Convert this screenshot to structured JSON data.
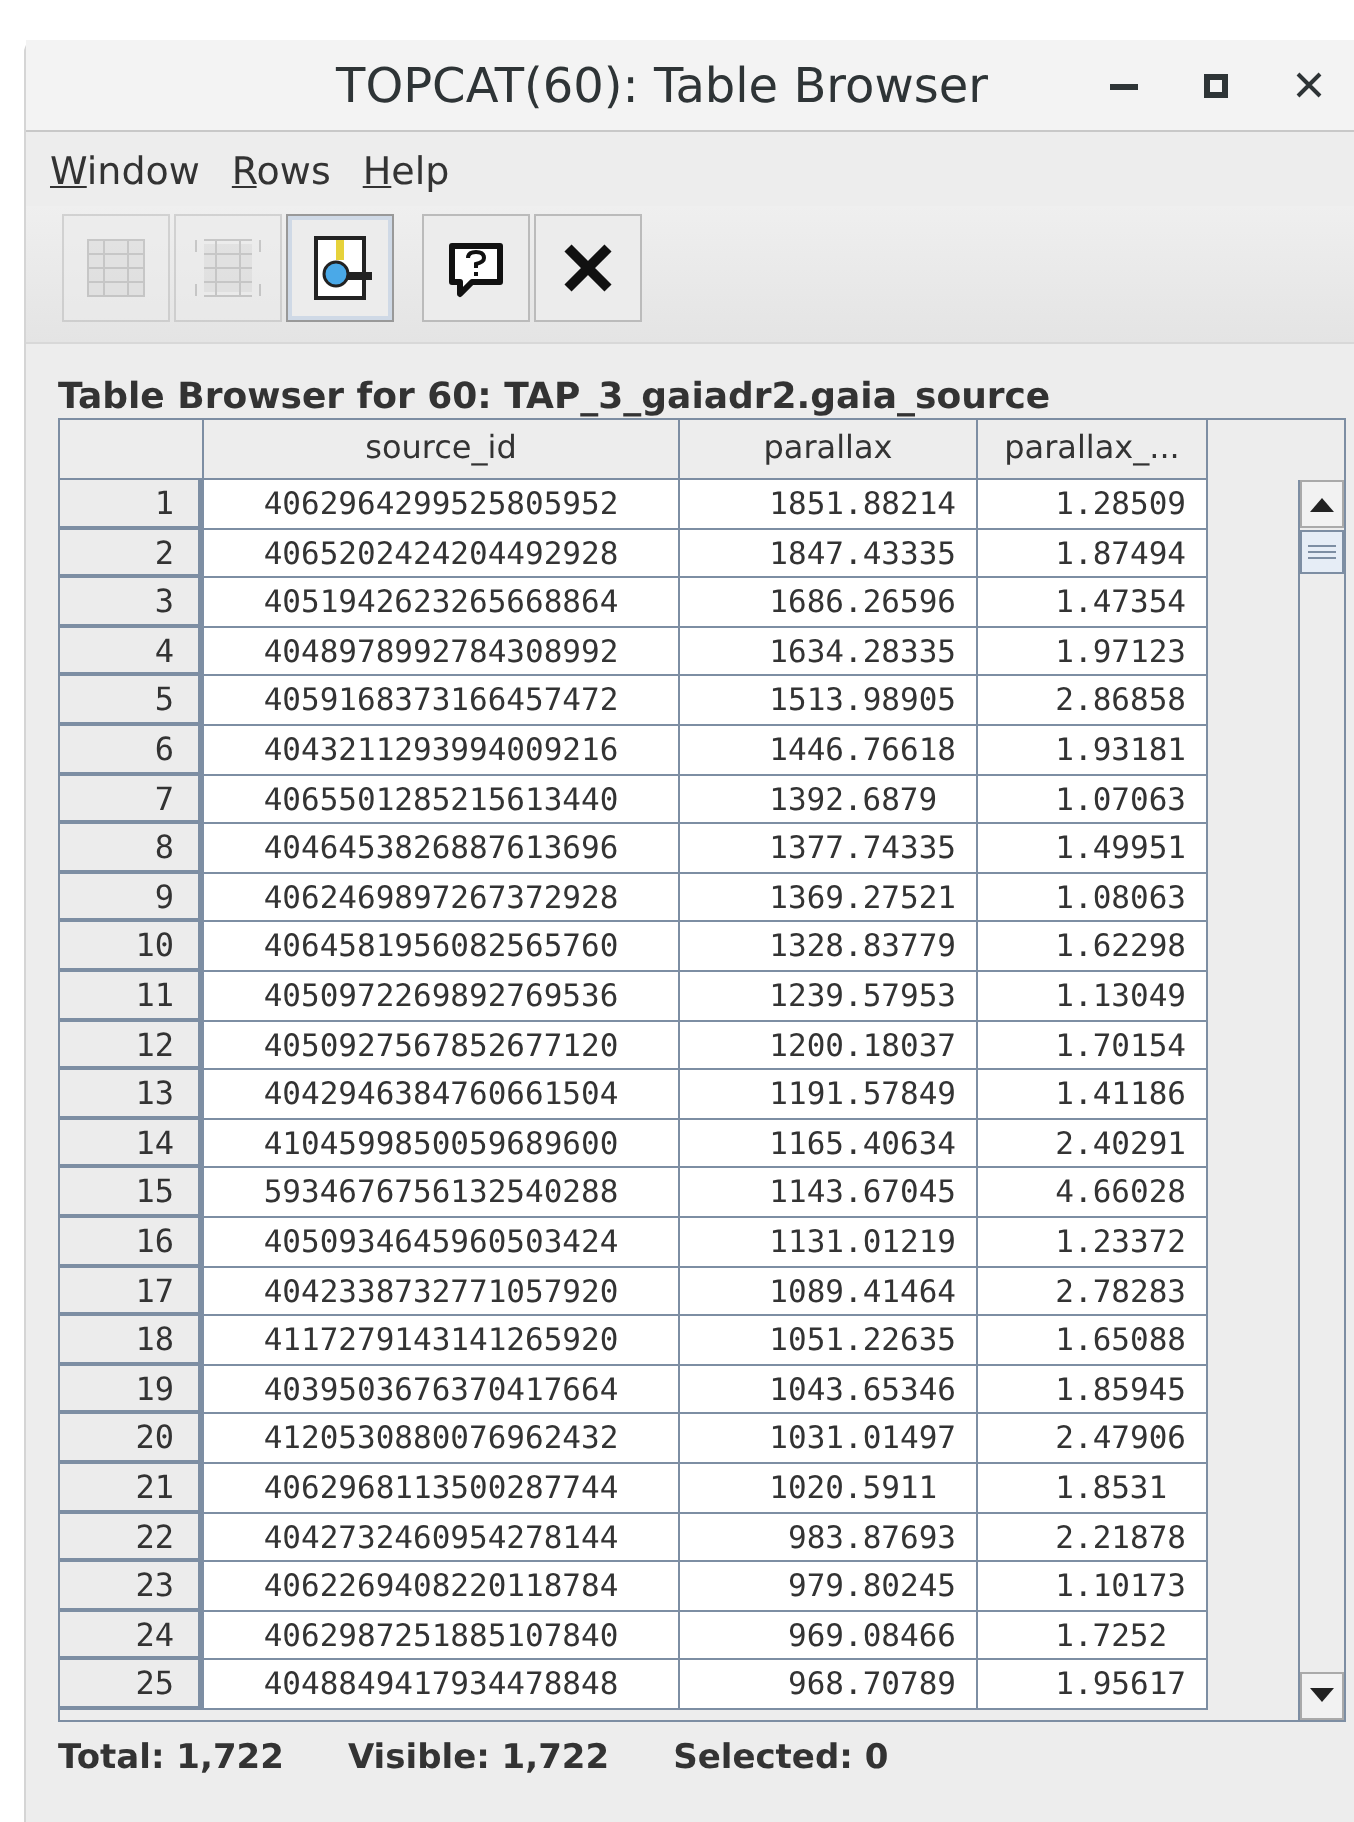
{
  "window": {
    "title": "TOPCAT(60): Table Browser"
  },
  "menu": [
    {
      "label": "Window"
    },
    {
      "label": "Rows"
    },
    {
      "label": "Help"
    }
  ],
  "toolbar": [
    {
      "kind": "table",
      "disabled": true,
      "selected": false
    },
    {
      "kind": "table-cut",
      "disabled": true,
      "selected": false
    },
    {
      "kind": "highlight",
      "disabled": false,
      "selected": true
    },
    {
      "kind": "help",
      "disabled": false,
      "selected": false
    },
    {
      "kind": "close",
      "disabled": false,
      "selected": false
    }
  ],
  "panel_title": "Table Browser for 60: TAP_3_gaiadr2.gaia_source",
  "table": {
    "columns": [
      "",
      "source_id",
      "parallax",
      "parallax_..."
    ],
    "rows": [
      [
        "1",
        "4062964299525805952",
        "1851.88214",
        "1.28509"
      ],
      [
        "2",
        "4065202424204492928",
        "1847.43335",
        "1.87494"
      ],
      [
        "3",
        "4051942623265668864",
        "1686.26596",
        "1.47354"
      ],
      [
        "4",
        "4048978992784308992",
        "1634.28335",
        "1.97123"
      ],
      [
        "5",
        "4059168373166457472",
        "1513.98905",
        "2.86858"
      ],
      [
        "6",
        "4043211293994009216",
        "1446.76618",
        "1.93181"
      ],
      [
        "7",
        "4065501285215613440",
        "1392.6879",
        "1.07063"
      ],
      [
        "8",
        "4046453826887613696",
        "1377.74335",
        "1.49951"
      ],
      [
        "9",
        "4062469897267372928",
        "1369.27521",
        "1.08063"
      ],
      [
        "10",
        "4064581956082565760",
        "1328.83779",
        "1.62298"
      ],
      [
        "11",
        "4050972269892769536",
        "1239.57953",
        "1.13049"
      ],
      [
        "12",
        "4050927567852677120",
        "1200.18037",
        "1.70154"
      ],
      [
        "13",
        "4042946384760661504",
        "1191.57849",
        "1.41186"
      ],
      [
        "14",
        "4104599850059689600",
        "1165.40634",
        "2.40291"
      ],
      [
        "15",
        "5934676756132540288",
        "1143.67045",
        "4.66028"
      ],
      [
        "16",
        "4050934645960503424",
        "1131.01219",
        "1.23372"
      ],
      [
        "17",
        "4042338732771057920",
        "1089.41464",
        "2.78283"
      ],
      [
        "18",
        "4117279143141265920",
        "1051.22635",
        "1.65088"
      ],
      [
        "19",
        "4039503676370417664",
        "1043.65346",
        "1.85945"
      ],
      [
        "20",
        "4120530880076962432",
        "1031.01497",
        "2.47906"
      ],
      [
        "21",
        "4062968113500287744",
        "1020.5911",
        "1.8531"
      ],
      [
        "22",
        "4042732460954278144",
        "983.87693",
        "2.21878"
      ],
      [
        "23",
        "4062269408220118784",
        "979.80245",
        "1.10173"
      ],
      [
        "24",
        "4062987251885107840",
        "969.08466",
        "1.7252"
      ],
      [
        "25",
        "4048849417934478848",
        "968.70789",
        "1.95617"
      ]
    ]
  },
  "status": {
    "total": "Total: 1,722",
    "visible": "Visible: 1,722",
    "selected": "Selected: 0"
  }
}
